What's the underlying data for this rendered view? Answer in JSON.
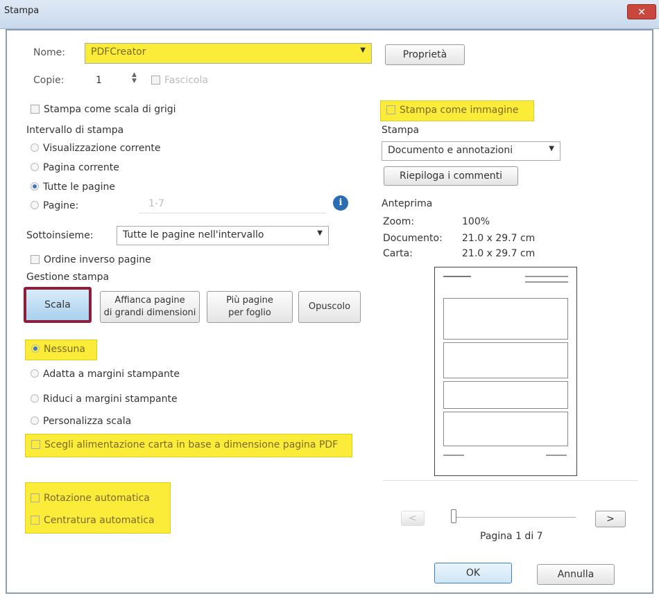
{
  "window": {
    "title": "Stampa",
    "close_glyph": "✕"
  },
  "printer": {
    "label": "Nome:",
    "value": "PDFCreator",
    "properties_label": "Proprietà"
  },
  "copies": {
    "label": "Copie:",
    "value": "1",
    "collate_label": "Fascicola"
  },
  "grayscale_label": "Stampa come scala di grigi",
  "print_as_image_label": "Stampa come immagine",
  "range": {
    "title": "Intervallo di stampa",
    "current_view": "Visualizzazione corrente",
    "current_page": "Pagina corrente",
    "all_pages": "Tutte le pagine",
    "pages": "Pagine:",
    "pages_value": "1-7"
  },
  "subset": {
    "label": "Sottoinsieme:",
    "value": "Tutte le pagine nell'intervallo"
  },
  "reverse_label": "Ordine inverso pagine",
  "handling": {
    "title": "Gestione stampa",
    "scale": "Scala",
    "tile_line1": "Affianca pagine",
    "tile_line2": "di grandi dimensioni",
    "multiple_line1": "Più pagine",
    "multiple_line2": "per foglio",
    "booklet": "Opuscolo"
  },
  "scaling": {
    "none": "Nessuna",
    "fit": "Adatta a margini stampante",
    "shrink": "Riduci a margini stampante",
    "custom": "Personalizza scala"
  },
  "paper_source_label": "Scegli alimentazione carta in base a dimensione pagina PDF",
  "auto_rotate_label": "Rotazione automatica",
  "auto_center_label": "Centratura automatica",
  "print_what": {
    "label": "Stampa",
    "value": "Documento e annotazioni",
    "summarize_label": "Riepiloga i commenti"
  },
  "preview": {
    "title": "Anteprima",
    "zoom_label": "Zoom:",
    "zoom_value": "100%",
    "document_label": "Documento:",
    "document_value": "21.0 x 29.7 cm",
    "paper_label": "Carta:",
    "paper_value": "21.0 x 29.7 cm",
    "page_indicator": "Pagina 1 di 7",
    "prev_glyph": "<",
    "next_glyph": ">"
  },
  "buttons": {
    "ok": "OK",
    "cancel": "Annulla"
  }
}
